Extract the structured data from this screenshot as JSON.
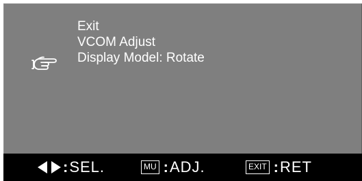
{
  "menu": {
    "items": [
      {
        "label": "Exit",
        "selected": false
      },
      {
        "label": "VCOM Adjust",
        "selected": false
      },
      {
        "label": "Display Model: Rotate",
        "selected": true
      }
    ],
    "pointer_icon": "pointing-hand-icon"
  },
  "status_bar": {
    "select": {
      "icon": "left-right-arrows-icon",
      "separator": ":",
      "label": "SEL."
    },
    "adjust": {
      "key": "MU",
      "separator": ":",
      "label": "ADJ."
    },
    "return": {
      "key": "EXIT",
      "separator": ":",
      "label": "RET"
    }
  },
  "colors": {
    "background": "#7f7f7f",
    "text": "#ffffff",
    "status_bar": "#000000"
  }
}
